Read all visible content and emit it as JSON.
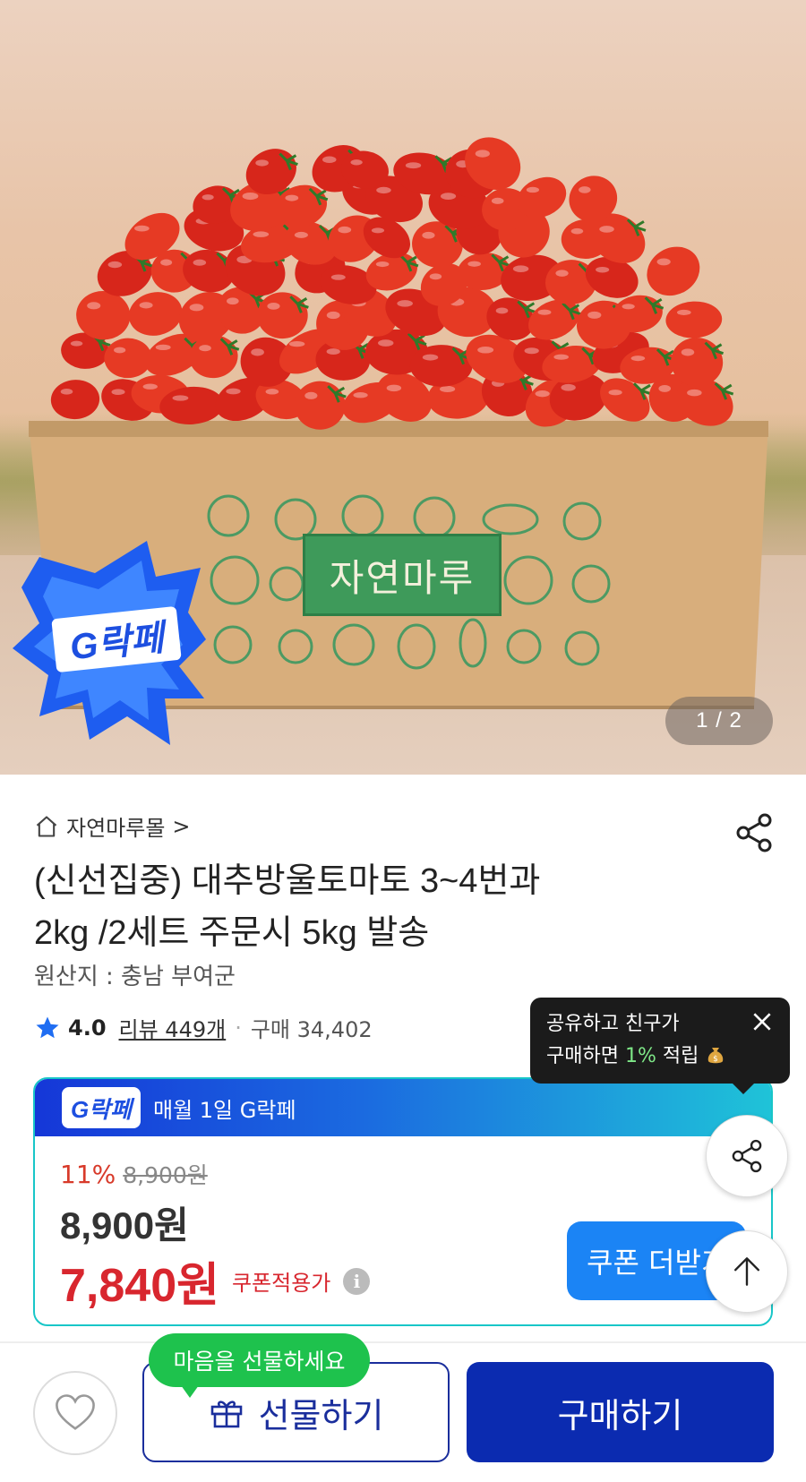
{
  "hero": {
    "box_logo_text": "자연마루",
    "badge_text": "G락페",
    "pager": "1 / 2"
  },
  "store": {
    "name": "자연마루몰",
    "chevron": ">"
  },
  "product": {
    "title_line1": "(신선집중) 대추방울토마토 3~4번과",
    "title_line2": "2kg /2세트 주문시 5kg 발송",
    "origin": "원산지 : 충남 부여군",
    "rating": "4.0",
    "reviews": "리뷰 449개",
    "dot": "·",
    "purchases": "구매 34,402"
  },
  "tooltip": {
    "line1": "공유하고 친구가",
    "line2_prefix": "구매하면 ",
    "line2_pct": "1%",
    "line2_suffix": " 적립"
  },
  "promo": {
    "mini_logo": "G락페",
    "banner_text": "매월 1일 G락페",
    "discount_pct": "11%",
    "original_price": "8,900원",
    "price": "8,900원",
    "coupon_price": "7,840원",
    "coupon_label": "쿠폰적용가",
    "info_icon": "i",
    "coupon_button": "쿠폰 더받기"
  },
  "bottom": {
    "gift_bubble": "마음을 선물하세요",
    "gift_button": "선물하기",
    "buy_button": "구매하기"
  },
  "colors": {
    "brand_blue": "#0b2bb0",
    "coupon_red": "#d8262e",
    "accent_blue": "#1b84f5",
    "green": "#1ec24d"
  },
  "icons": [
    "home-icon",
    "share-icon",
    "star-icon",
    "close-icon",
    "money-bag-icon",
    "info-icon",
    "arrow-up-icon",
    "heart-icon",
    "gift-icon"
  ]
}
